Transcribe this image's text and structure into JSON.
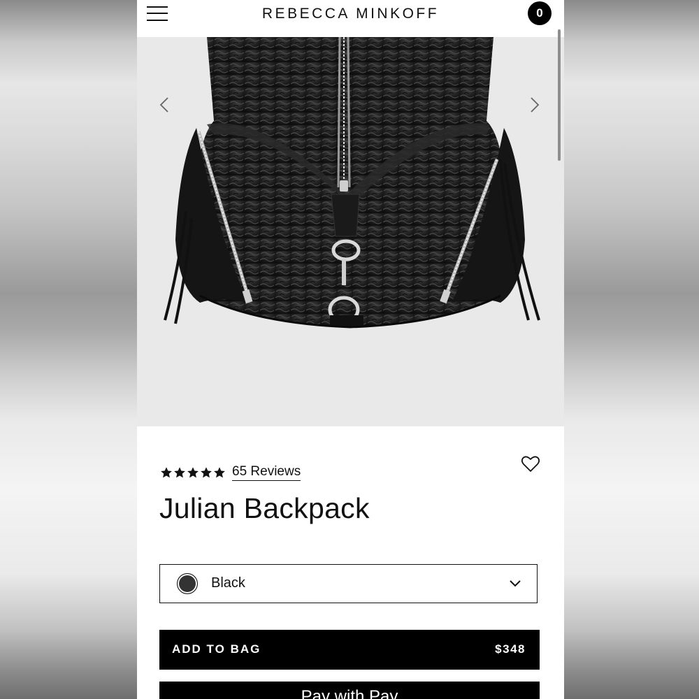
{
  "header": {
    "brand": "REBECCA MINKOFF",
    "cart_count": "0"
  },
  "product": {
    "rating_stars": 5,
    "reviews_label": "65 Reviews",
    "title": "Julian Backpack",
    "color": {
      "selected": "Black",
      "swatch_color": "#333333"
    },
    "add_to_bag": {
      "label": "ADD TO BAG",
      "price": "$348"
    },
    "apple_pay": {
      "label": "Pay with  Pay"
    }
  },
  "colors": {
    "button_bg": "#000000",
    "gallery_bg": "#e9e9e9",
    "text": "#111111"
  },
  "icons": {
    "menu": "hamburger-icon",
    "prev": "chevron-left-icon",
    "next": "chevron-right-icon",
    "wishlist": "heart-icon",
    "dropdown": "chevron-down-icon",
    "star": "star-icon"
  }
}
